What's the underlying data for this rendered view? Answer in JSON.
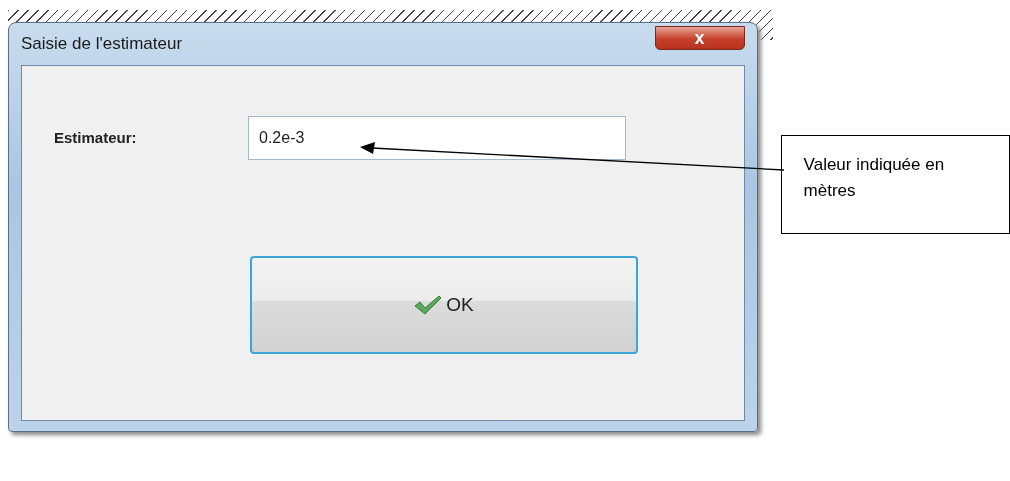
{
  "window": {
    "title": "Saisie de l'estimateur",
    "close_button": "x"
  },
  "form": {
    "label": "Estimateur:",
    "value": "0.2e-3"
  },
  "buttons": [
    "OK"
  ],
  "callout": {
    "text": "Valeur indiquée en mètres"
  }
}
